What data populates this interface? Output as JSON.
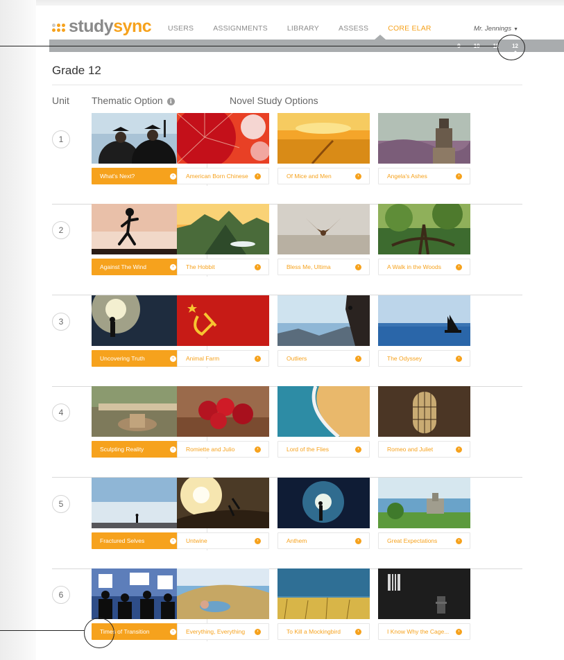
{
  "brand": {
    "study": "study",
    "sync": "sync",
    "accent": "#f6a21d"
  },
  "nav": {
    "items": [
      {
        "label": "USERS",
        "active": false
      },
      {
        "label": "ASSIGNMENTS",
        "active": false
      },
      {
        "label": "LIBRARY",
        "active": false
      },
      {
        "label": "ASSESS",
        "active": false
      },
      {
        "label": "CORE ELAR",
        "active": true
      }
    ],
    "user": "Mr. Jennings",
    "user_caret": "▼"
  },
  "grades": [
    "9",
    "10",
    "11",
    "12"
  ],
  "active_grade": "12",
  "page": {
    "title": "Grade 12",
    "col_unit": "Unit",
    "col_thematic": "Thematic Option",
    "col_thematic_icon": "info-icon",
    "col_novel": "Novel Study Options"
  },
  "units": [
    {
      "number": "1",
      "thematic": "What's Next?",
      "novels": [
        "American Born Chinese",
        "Of Mice and Men",
        "Angela's Ashes"
      ]
    },
    {
      "number": "2",
      "thematic": "Against The Wind",
      "novels": [
        "The Hobbit",
        "Bless Me, Ultima",
        "A Walk in the Woods"
      ]
    },
    {
      "number": "3",
      "thematic": "Uncovering Truth",
      "novels": [
        "Animal Farm",
        "Outliers",
        "The Odyssey"
      ]
    },
    {
      "number": "4",
      "thematic": "Sculpting Reality",
      "novels": [
        "Romiette and Julio",
        "Lord of the Flies",
        "Romeo and Juliet"
      ]
    },
    {
      "number": "5",
      "thematic": "Fractured Selves",
      "novels": [
        "Untwine",
        "Anthem",
        "Great Expectations"
      ]
    },
    {
      "number": "6",
      "thematic": "Times of Transition",
      "novels": [
        "Everything, Everything",
        "To Kill a Mockingbird",
        "I Know Why the Cage..."
      ]
    }
  ]
}
